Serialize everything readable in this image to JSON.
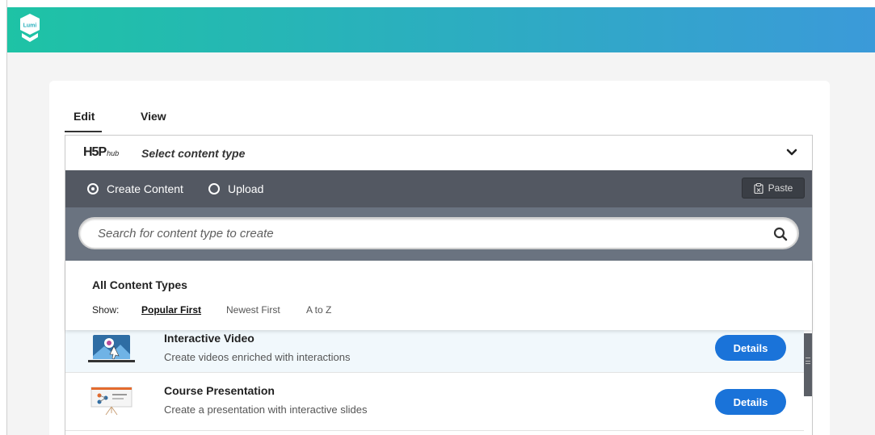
{
  "app": {
    "logo_text": "Lumi",
    "brand_colors": {
      "gradient_start": "#1ec3a5",
      "gradient_end": "#3b9ad9"
    }
  },
  "tabs": [
    {
      "label": "Edit",
      "active": true
    },
    {
      "label": "View",
      "active": false
    }
  ],
  "hub": {
    "logo_main": "H5P",
    "logo_sub": "hub",
    "title": "Select content type",
    "modes": [
      {
        "label": "Create Content",
        "selected": true
      },
      {
        "label": "Upload",
        "selected": false
      }
    ],
    "paste_label": "Paste",
    "search": {
      "placeholder": "Search for content type to create",
      "value": ""
    },
    "list_header": {
      "title": "All Content Types",
      "show_label": "Show:",
      "sort_options": [
        {
          "label": "Popular First",
          "active": true
        },
        {
          "label": "Newest First",
          "active": false
        },
        {
          "label": "A to Z",
          "active": false
        }
      ]
    },
    "items": [
      {
        "title": "Interactive Video",
        "description": "Create videos enriched with interactions",
        "button": "Details",
        "icon": "interactive-video-icon"
      },
      {
        "title": "Course Presentation",
        "description": "Create a presentation with interactive slides",
        "button": "Details",
        "icon": "course-presentation-icon"
      }
    ],
    "accent_color": "#1a73d9"
  }
}
